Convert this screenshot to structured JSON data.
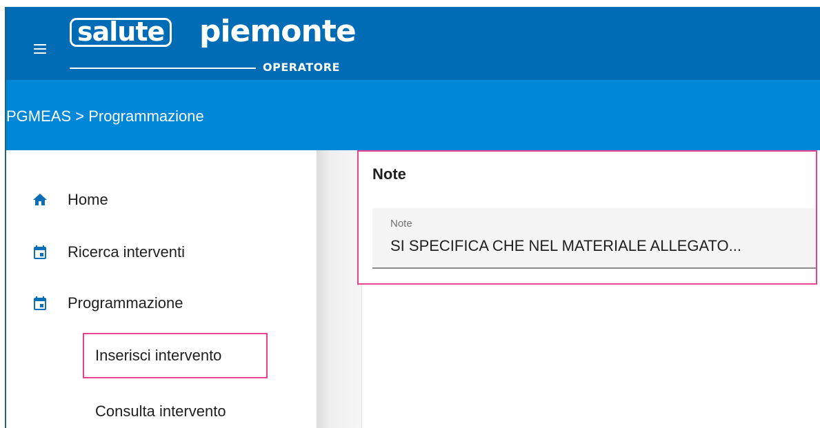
{
  "header": {
    "logo_salute": "salute",
    "logo_piemonte": "piemonte",
    "logo_sub": "OPERATORE",
    "menu_icon": "hamburger-menu-icon"
  },
  "breadcrumb": {
    "text": "PGMEAS > Programmazione"
  },
  "sidebar": {
    "items": [
      {
        "label": "Home",
        "icon": "home-icon"
      },
      {
        "label": "Ricerca interventi",
        "icon": "calendar-icon"
      },
      {
        "label": "Programmazione",
        "icon": "calendar-icon"
      }
    ],
    "subitems": [
      {
        "label": "Inserisci intervento"
      },
      {
        "label": "Consulta intervento"
      }
    ]
  },
  "note_panel": {
    "title": "Note",
    "field_label": "Note",
    "field_value": "SI SPECIFICA CHE NEL MATERIALE ALLEGATO..."
  },
  "colors": {
    "header": "#006cb5",
    "breadcrumb_band": "#0087d8",
    "highlight": "#e8418f",
    "icon": "#0b6eb8"
  }
}
